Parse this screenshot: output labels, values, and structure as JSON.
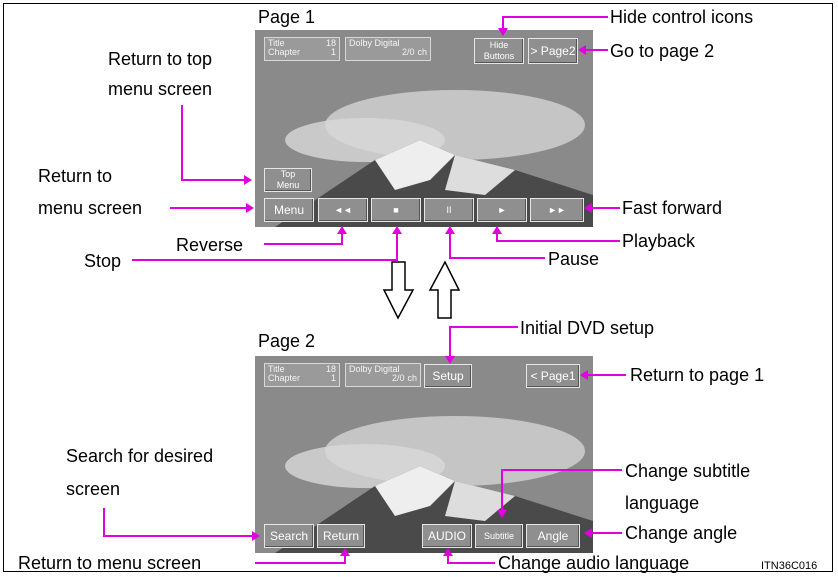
{
  "screen1": {
    "title": "Page 1",
    "info_title": "Title",
    "info_title_num": "18",
    "info_chapter": "Chapter",
    "info_chapter_num": "1",
    "audio_format": "Dolby Digital",
    "audio_channels": "2/0",
    "audio_unit": "ch",
    "hide_buttons": "Hide\nButtons",
    "page2": "> Page2",
    "top_menu": "Top\nMenu",
    "menu": "Menu",
    "rewind_icon": "◄◄",
    "stop_icon": "■",
    "pause_icon": "II",
    "play_icon": "►",
    "ff_icon": "►►"
  },
  "screen2": {
    "title": "Page 2",
    "info_title": "Title",
    "info_title_num": "18",
    "info_chapter": "Chapter",
    "info_chapter_num": "1",
    "audio_format": "Dolby Digital",
    "audio_channels": "2/0",
    "audio_unit": "ch",
    "setup": "Setup",
    "page1": "< Page1",
    "search": "Search",
    "return": "Return",
    "audio": "AUDIO",
    "subtitle": "Subtitle",
    "angle": "Angle"
  },
  "callouts": {
    "hide_icons": "Hide control icons",
    "goto_page2": "Go to page 2",
    "return_top_menu_1": "Return to top",
    "return_top_menu_2": "menu screen",
    "return_menu_1": "Return to",
    "return_menu_2": "menu screen",
    "fast_forward": "Fast forward",
    "playback": "Playback",
    "reverse": "Reverse",
    "stop": "Stop",
    "pause": "Pause",
    "dvd_setup": "Initial DVD setup",
    "return_page1": "Return to page 1",
    "search_1": "Search for desired",
    "search_2": "screen",
    "change_subtitle_1": "Change subtitle",
    "change_subtitle_2": "language",
    "change_angle": "Change angle",
    "return_menu_bottom": "Return to menu screen",
    "change_audio": "Change audio language"
  },
  "figure_code": "ITN36C016",
  "colors": {
    "callout_line": "#e000e0",
    "button_bg": "#8f8f8f",
    "screen_border": "#e6e6e6"
  }
}
